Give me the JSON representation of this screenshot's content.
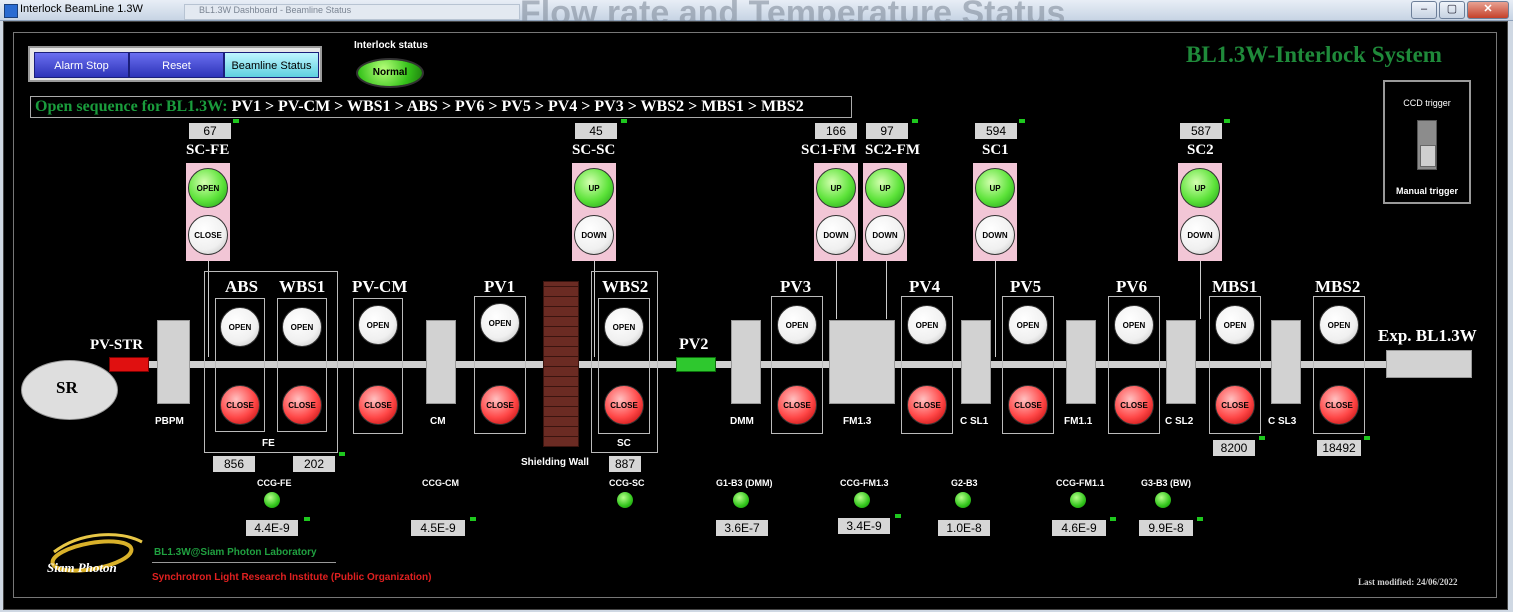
{
  "window": {
    "title": "Interlock BeamLine 1.3W",
    "ghost_title": "Flow rate and Temperature Status",
    "ghost_tab": "BL1.3W Dashboard - Beamline Status",
    "minimize": "–",
    "maximize": "▢",
    "close": "✕"
  },
  "toolbar": {
    "alarm_stop": "Alarm Stop",
    "reset": "Reset",
    "beamline_status": "Beamline Status"
  },
  "interlock": {
    "label": "Interlock status",
    "state": "Normal"
  },
  "sequence": {
    "prefix": "Open sequence for BL1.3W:",
    "steps": "PV1 > PV-CM > WBS1 > ABS > PV6 > PV5 > PV4 > PV3 > WBS2 > MBS1 > MBS2"
  },
  "system_title": "BL1.3W-Interlock System",
  "ccd": {
    "title": "CCD trigger",
    "button": "Manual trigger"
  },
  "top_values": {
    "sc_fe": "67",
    "sc_sc": "45",
    "sc1_fm": "166",
    "sc2_fm": "97",
    "sc1": "594",
    "sc2": "587"
  },
  "scrapers": {
    "sc_fe": {
      "name": "SC-FE",
      "a": "OPEN",
      "b": "CLOSE"
    },
    "sc_sc": {
      "name": "SC-SC",
      "a": "UP",
      "b": "DOWN"
    },
    "sc1_fm": {
      "name": "SC1-FM",
      "a": "UP",
      "b": "DOWN"
    },
    "sc2_fm": {
      "name": "SC2-FM",
      "a": "UP",
      "b": "DOWN"
    },
    "sc1": {
      "name": "SC1",
      "a": "UP",
      "b": "DOWN"
    },
    "sc2": {
      "name": "SC2",
      "a": "UP",
      "b": "DOWN"
    }
  },
  "valves": {
    "abs": {
      "name": "ABS",
      "open": "OPEN",
      "close": "CLOSE"
    },
    "wbs1": {
      "name": "WBS1",
      "open": "OPEN",
      "close": "CLOSE"
    },
    "pv_cm": {
      "name": "PV-CM",
      "open": "OPEN",
      "close": "CLOSE"
    },
    "pv1": {
      "name": "PV1",
      "open": "OPEN",
      "close": "CLOSE"
    },
    "wbs2": {
      "name": "WBS2",
      "open": "OPEN",
      "close": "CLOSE"
    },
    "pv3": {
      "name": "PV3",
      "open": "OPEN",
      "close": "CLOSE"
    },
    "pv4": {
      "name": "PV4",
      "open": "OPEN",
      "close": "CLOSE"
    },
    "pv5": {
      "name": "PV5",
      "open": "OPEN",
      "close": "CLOSE"
    },
    "pv6": {
      "name": "PV6",
      "open": "OPEN",
      "close": "CLOSE"
    },
    "mbs1": {
      "name": "MBS1",
      "open": "OPEN",
      "close": "CLOSE"
    },
    "mbs2": {
      "name": "MBS2",
      "open": "OPEN",
      "close": "CLOSE"
    }
  },
  "labels": {
    "pv_str": "PV-STR",
    "sr": "SR",
    "pbpm": "PBPM",
    "fe": "FE",
    "cm": "CM",
    "shielding_wall": "Shielding Wall",
    "sc": "SC",
    "pv2": "PV2",
    "dmm": "DMM",
    "fm13": "FM1.3",
    "csl1": "C SL1",
    "fm11": "FM1.1",
    "csl2": "C SL2",
    "csl3": "C SL3",
    "exp": "Exp. BL1.3W"
  },
  "bottom_values": {
    "abs": "856",
    "wbs1": "202",
    "wbs2": "887",
    "mbs1": "8200",
    "mbs2": "18492"
  },
  "gauges": [
    {
      "name": "CCG-FE",
      "value": "4.4E-9"
    },
    {
      "name": "CCG-CM",
      "value": "4.5E-9"
    },
    {
      "name": "CCG-SC",
      "value": ""
    },
    {
      "name": "G1-B3 (DMM)",
      "value": "3.6E-7"
    },
    {
      "name": "CCG-FM1.3",
      "value": "3.4E-9"
    },
    {
      "name": "G2-B3",
      "value": "1.0E-8"
    },
    {
      "name": "CCG-FM1.1",
      "value": "4.6E-9"
    },
    {
      "name": "G3-B3 (BW)",
      "value": "9.9E-8"
    }
  ],
  "footer": {
    "lab": "BL1.3W@Siam Photon Laboratory",
    "institute": "Synchrotron Light Research Institute (Public Organization)",
    "logo": "Siam Photon",
    "modified": "Last modified: 24/06/2022"
  },
  "colors": {
    "accent_green": "#1f8a3a",
    "pink": "#f2c6d6",
    "background": "#000000"
  }
}
